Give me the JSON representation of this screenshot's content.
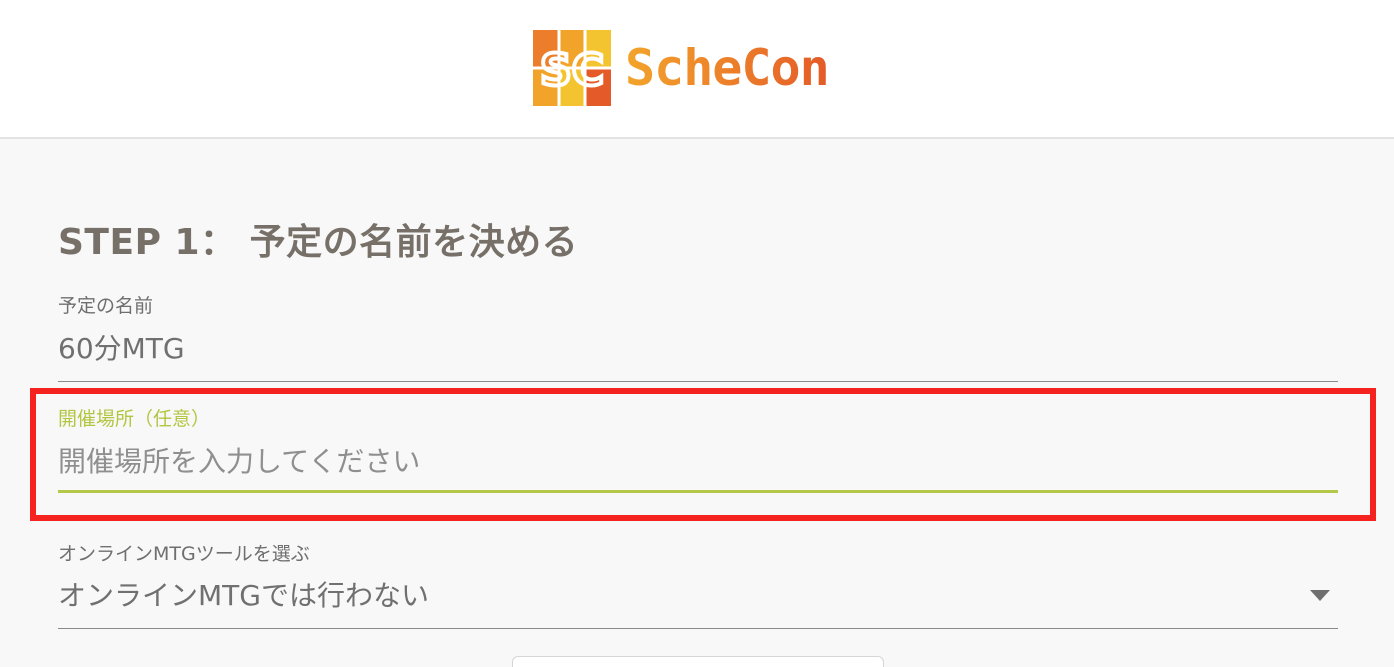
{
  "header": {
    "logo_mark": "SC",
    "logo_text": "ScheCon",
    "colors": {
      "yellow": "#f4c430",
      "orange": "#ec7d2a",
      "red_orange": "#e45a28"
    }
  },
  "step": {
    "title": "STEP 1： 予定の名前を決める"
  },
  "fields": {
    "name": {
      "label": "予定の名前",
      "value": "60分MTG"
    },
    "location": {
      "label": "開催場所（任意）",
      "value": "",
      "placeholder": "開催場所を入力してください",
      "accent_color": "#b6c84a"
    },
    "online_tool": {
      "label": "オンラインMTGツールを選ぶ",
      "selected": "オンラインMTGでは行わない",
      "icon": "chevron-down-icon"
    }
  },
  "highlight": {
    "color": "#f4231f"
  }
}
